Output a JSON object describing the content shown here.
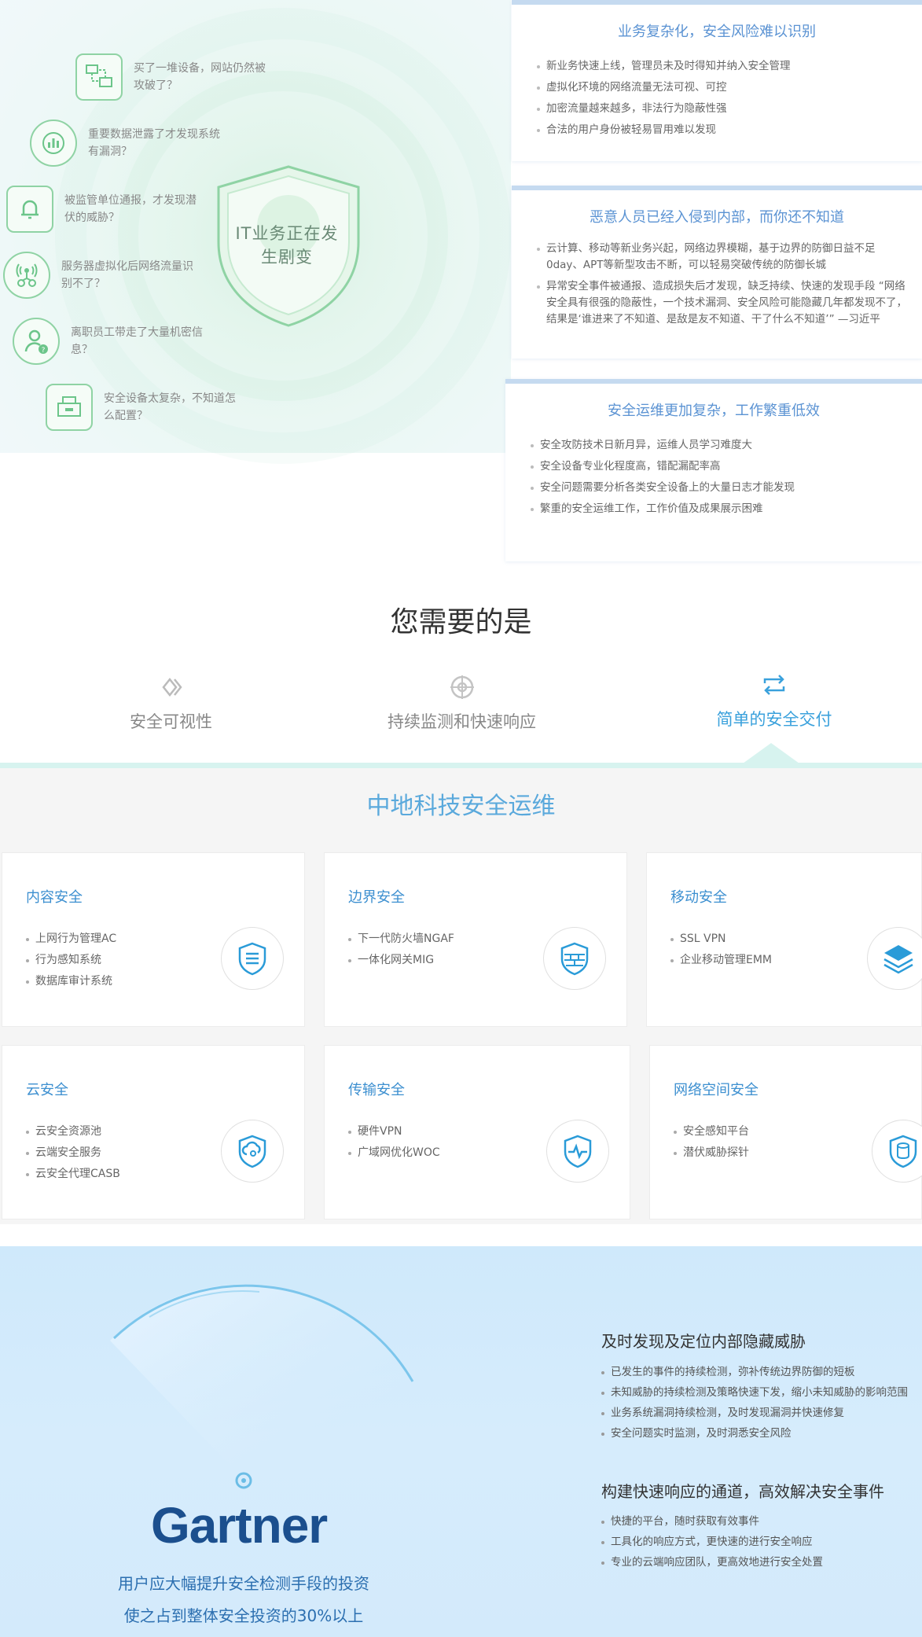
{
  "problems": {
    "left_items": [
      {
        "text": "买了一堆设备，网站仍然被攻破了？",
        "icon": "network-monitor-icon"
      },
      {
        "text": "重要数据泄露了才发现系统有漏洞？",
        "icon": "data-chart-icon"
      },
      {
        "text": "被监管单位通报，才发现潜伏的威胁？",
        "icon": "alarm-bell-icon"
      },
      {
        "text": "服务器虚拟化后网络流量识别不了？",
        "icon": "virtual-network-icon"
      },
      {
        "text": "离职员工带走了大量机密信息？",
        "icon": "user-question-icon"
      },
      {
        "text": "安全设备太复杂，不知道怎么配置？",
        "icon": "device-printer-icon"
      }
    ],
    "center_shield": "IT业务正在发生剧变",
    "cards": [
      {
        "title": "业务复杂化，安全风险难以识别",
        "bullets": [
          "新业务快速上线，管理员未及时得知并纳入安全管理",
          "虚拟化环境的网络流量无法可视、可控",
          "加密流量越来越多，非法行为隐蔽性强",
          "合法的用户身份被轻易冒用难以发现"
        ]
      },
      {
        "title": "恶意人员已经入侵到内部，而你还不知道",
        "bullets": [
          "云计算、移动等新业务兴起，网络边界模糊，基于边界的防御日益不足0day、APT等新型攻击不断，可以轻易突破传统的防御长城",
          "异常安全事件被通报、造成损失后才发现，缺乏持续、快速的发现手段 “网络安全具有很强的隐蔽性，一个技术漏洞、安全风险可能隐藏几年都发现不了，结果是‘谁进来了不知道、是敌是友不知道、干了什么不知道’” —习近平"
        ]
      },
      {
        "title": "安全运维更加复杂，工作繁重低效",
        "bullets": [
          "安全攻防技术日新月异，运维人员学习难度大",
          "安全设备专业化程度高，错配漏配率高",
          "安全问题需要分析各类安全设备上的大量日志才能发现",
          "繁重的安全运维工作，工作价值及成果展示困难"
        ]
      }
    ]
  },
  "need": {
    "title": "您需要的是",
    "tabs": [
      {
        "label": "安全可视性",
        "icon": "chevron-diamond-icon",
        "active": false
      },
      {
        "label": "持续监测和快速响应",
        "icon": "crosshair-icon",
        "active": false
      },
      {
        "label": "简单的安全交付",
        "icon": "refresh-arrows-icon",
        "active": true
      }
    ]
  },
  "ops": {
    "title": "中地科技安全运维",
    "cards": [
      {
        "title": "内容安全",
        "items": [
          "上网行为管理AC",
          "行为感知系统",
          "数据库审计系统"
        ],
        "icon": "document-shield-icon"
      },
      {
        "title": "边界安全",
        "items": [
          "下一代防火墙NGAF",
          "一体化网关MIG"
        ],
        "icon": "firewall-brick-icon"
      },
      {
        "title": "移动安全",
        "items": [
          "SSL VPN",
          "企业移动管理EMM"
        ],
        "icon": "mobile-layers-icon"
      },
      {
        "title": "云安全",
        "items": [
          "云安全资源池",
          "云端安全服务",
          "云安全代理CASB"
        ],
        "icon": "cloud-shield-icon"
      },
      {
        "title": "传输安全",
        "items": [
          "硬件VPN",
          "广域网优化WOC"
        ],
        "icon": "pulse-shield-icon"
      },
      {
        "title": "网络空间安全",
        "items": [
          "安全感知平台",
          "潜伏威胁探针"
        ],
        "icon": "database-shield-icon"
      }
    ]
  },
  "gartner": {
    "logo": "Gartner",
    "line1": "用户应大幅提升安全检测手段的投资",
    "line2": "使之占到整体安全投资的30%以上",
    "sections": [
      {
        "heading": "及时发现及定位内部隐藏威胁",
        "bullets": [
          "已发生的事件的持续检测，弥补传统边界防御的短板",
          "未知威胁的持续检测及策略快速下发，缩小未知威胁的影响范围",
          "业务系统漏洞持续检测，及时发现漏洞并快速修复",
          "安全问题实时监测，及时洞悉安全风险"
        ]
      },
      {
        "heading": "构建快速响应的通道，高效解决安全事件",
        "bullets": [
          "快捷的平台，随时获取有效事件",
          "工具化的响应方式，更快速的进行安全响应",
          "专业的云端响应团队，更高效地进行安全处置"
        ]
      }
    ]
  },
  "colors": {
    "accent": "#3aa1dc",
    "green": "#8fd3a4",
    "title_blue": "#5b93d3",
    "gartner_blue": "#1b4f8e"
  }
}
